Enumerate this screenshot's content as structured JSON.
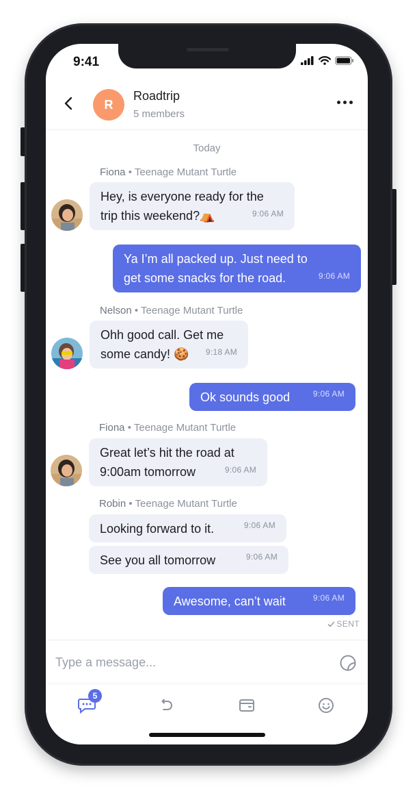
{
  "status_bar": {
    "time": "9:41"
  },
  "header": {
    "avatar_letter": "R",
    "title": "Roadtrip",
    "subtitle": "5 members"
  },
  "day_divider": "Today",
  "messages": [
    {
      "sender": "Fiona",
      "role": "Teenage Mutant Turtle",
      "lines": [
        "Hey, is everyone ready for the",
        "trip this weekend?⛺"
      ],
      "time": "9:06 AM"
    },
    {
      "lines": [
        "Ya I’m all packed up. Just need to",
        "get some snacks for the road."
      ],
      "time": "9:06 AM"
    },
    {
      "sender": "Nelson",
      "role": "Teenage Mutant Turtle",
      "lines": [
        "Ohh good call. Get me",
        "some candy! 🍪"
      ],
      "time": "9:18 AM"
    },
    {
      "lines": [
        "Ok sounds good"
      ],
      "time": "9:06 AM"
    },
    {
      "sender": "Fiona",
      "role": "Teenage Mutant Turtle",
      "lines": [
        "Great let’s hit the road at",
        "9:00am tomorrow"
      ],
      "time": "9:06 AM"
    },
    {
      "sender": "Robin",
      "role": "Teenage Mutant Turtle",
      "lines": [
        "Looking forward to it."
      ],
      "time": "9:06 AM"
    },
    {
      "lines": [
        "See you all tomorrow"
      ],
      "time": "9:06 AM"
    },
    {
      "lines": [
        "Awesome, can’t wait"
      ],
      "time": "9:06 AM"
    }
  ],
  "delivery_status": "SENT",
  "composer": {
    "placeholder": "Type a message..."
  },
  "tabbar": {
    "chat_badge": "5"
  },
  "colors": {
    "accent": "#5a6ee6",
    "incoming_bubble": "#eef0f8",
    "avatar_r": "#fa9a6c"
  }
}
